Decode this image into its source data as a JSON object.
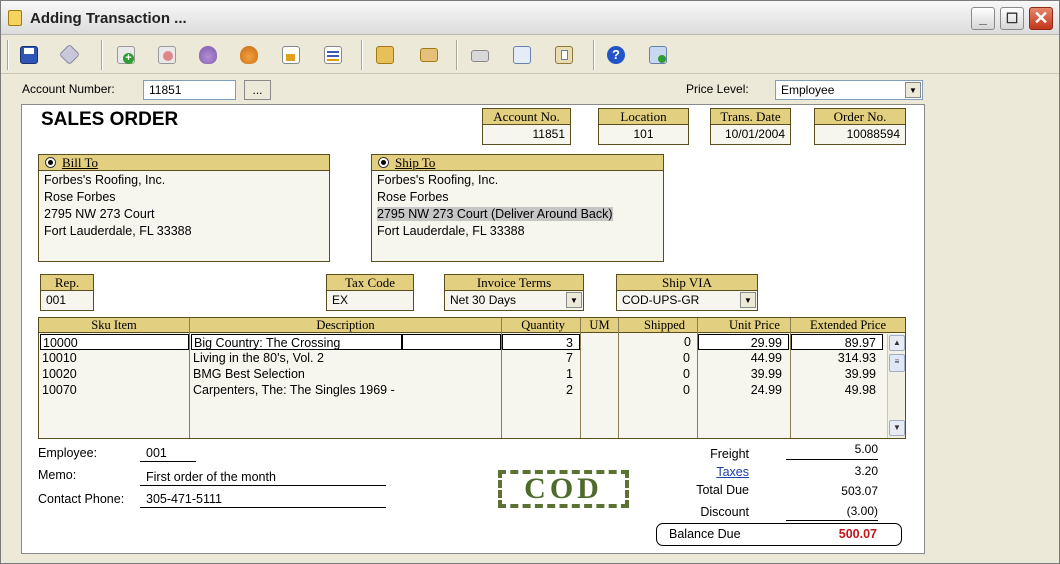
{
  "window": {
    "title": "Adding Transaction ..."
  },
  "toolbar": {
    "buttons": [
      "save-icon",
      "preview-icon",
      "add-icon",
      "delete-icon",
      "flask-icon",
      "flask-check-icon",
      "export-icon",
      "report-icon",
      "folder-icon",
      "envelope-icon",
      "print-icon",
      "copy-icon",
      "paste-icon",
      "help-icon",
      "exit-icon"
    ]
  },
  "top": {
    "account_label": "Account Number:",
    "account_value": "11851",
    "lookup_label": "...",
    "price_level_label": "Price Level:",
    "price_level_value": "Employee"
  },
  "doc": {
    "title": "SALES ORDER",
    "header_fields": [
      {
        "label": "Account No.",
        "value": "11851"
      },
      {
        "label": "Location",
        "value": "101"
      },
      {
        "label": "Trans. Date",
        "value": "10/01/2004"
      },
      {
        "label": "Order No.",
        "value": "10088594"
      }
    ],
    "bill_to": {
      "label": "Bill To",
      "lines": [
        "Forbes's Roofing, Inc.",
        "Rose Forbes",
        "2795 NW 273 Court",
        "Fort Lauderdale, FL 33388"
      ]
    },
    "ship_to": {
      "label": "Ship To",
      "lines": [
        "Forbes's Roofing, Inc.",
        "Rose Forbes",
        "2795 NW 273 Court  (Deliver Around Back)",
        "Fort Lauderdale, FL 33388"
      ]
    },
    "rep": {
      "label": "Rep.",
      "value": "001"
    },
    "tax_code": {
      "label": "Tax Code",
      "value": "EX"
    },
    "invoice_terms": {
      "label": "Invoice Terms",
      "value": "Net 30 Days"
    },
    "ship_via": {
      "label": "Ship VIA",
      "value": "COD-UPS-GR"
    }
  },
  "grid": {
    "columns": [
      "Sku Item",
      "Description",
      "Quantity",
      "UM",
      "Shipped",
      "Unit Price",
      "Extended Price"
    ],
    "rows": [
      {
        "sku": "10000",
        "desc": "Big Country: The Crossing",
        "qty": "3",
        "um": "",
        "shipped": "0",
        "unit": "29.99",
        "ext": "89.97"
      },
      {
        "sku": "10010",
        "desc": "Living in the 80's, Vol. 2",
        "qty": "7",
        "um": "",
        "shipped": "0",
        "unit": "44.99",
        "ext": "314.93"
      },
      {
        "sku": "10020",
        "desc": "BMG Best Selection",
        "qty": "1",
        "um": "",
        "shipped": "0",
        "unit": "39.99",
        "ext": "39.99"
      },
      {
        "sku": "10070",
        "desc": "Carpenters, The: The Singles 1969 -",
        "qty": "2",
        "um": "",
        "shipped": "0",
        "unit": "24.99",
        "ext": "49.98"
      }
    ]
  },
  "footer": {
    "employee_label": "Employee:",
    "employee_value": "001",
    "memo_label": "Memo:",
    "memo_value": "First order of the month",
    "phone_label": "Contact Phone:",
    "phone_value": "305-471-5111",
    "stamp": "COD"
  },
  "totals": {
    "freight_label": "Freight",
    "freight_value": "5.00",
    "taxes_label": "Taxes",
    "taxes_value": "3.20",
    "total_label": "Total Due",
    "total_value": "503.07",
    "discount_label": "Discount",
    "discount_value": "(3.00)",
    "balance_label": "Balance Due",
    "balance_value": "500.07"
  },
  "colors": {
    "header_fill": "#e2cf7f",
    "field_fill": "#f7f6ee",
    "balance_red": "#c0151a",
    "stamp_green": "#4e6a2c",
    "link_blue": "#1d3ea6"
  }
}
